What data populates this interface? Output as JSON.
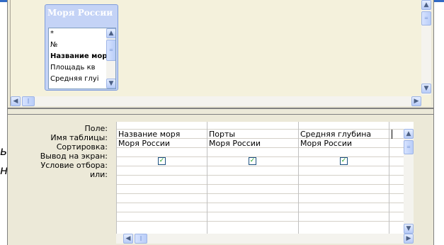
{
  "field_list": {
    "title": "Моря России",
    "fields": [
      "*",
      "№",
      "Название мор",
      "Площадь кв",
      "Средняя глуі"
    ]
  },
  "grid": {
    "row_labels": [
      "Поле:",
      "Имя таблицы:",
      "Сортировка:",
      "Вывод на экран:",
      "Условие отбора:",
      "или:"
    ],
    "columns": [
      {
        "field": "Название моря",
        "table": "Моря России",
        "show": true
      },
      {
        "field": "Порты",
        "table": "Моря России",
        "show": true
      },
      {
        "field": "Средняя глубина",
        "table": "Моря России",
        "show": true
      }
    ]
  },
  "behind_text": [
    "ь",
    "нı"
  ],
  "icons": {
    "checkbox_checked": "check-icon",
    "scroll_up": "arrow-up-icon",
    "scroll_down": "arrow-down-icon",
    "scroll_left": "arrow-left-icon",
    "scroll_right": "arrow-right-icon"
  }
}
